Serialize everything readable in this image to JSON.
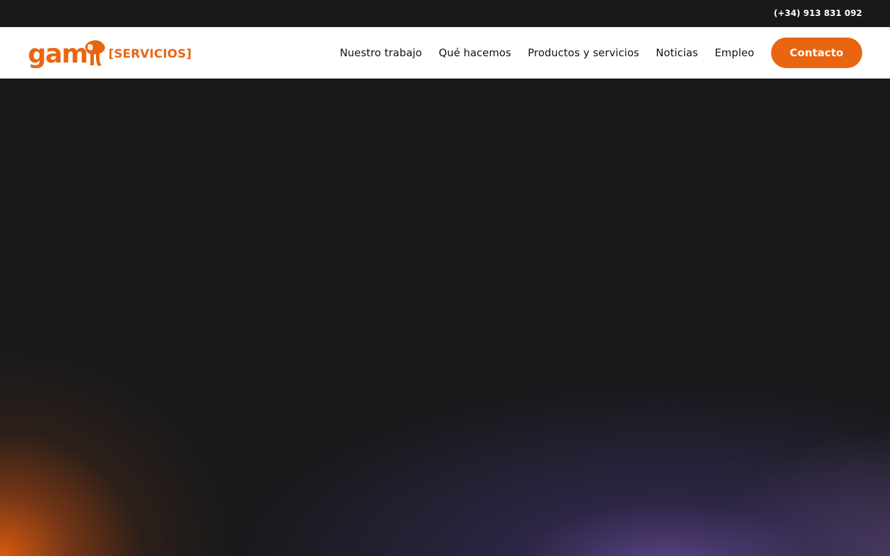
{
  "topbar": {
    "phone": "(+34) 913 831 092"
  },
  "header": {
    "logo": {
      "wordmark": "gam",
      "icon": "elephant-icon",
      "suffix": "[SERVICIOS]"
    },
    "nav": [
      {
        "label": "Nuestro trabajo"
      },
      {
        "label": "Qué hacemos"
      },
      {
        "label": "Productos y servicios"
      },
      {
        "label": "Noticias"
      },
      {
        "label": "Empleo"
      }
    ],
    "cta_label": "Contacto"
  },
  "colors": {
    "brand_orange": "#ea6510",
    "dark_background": "#18191b",
    "header_background": "#ffffff",
    "glow_purple": "#7052a8"
  }
}
